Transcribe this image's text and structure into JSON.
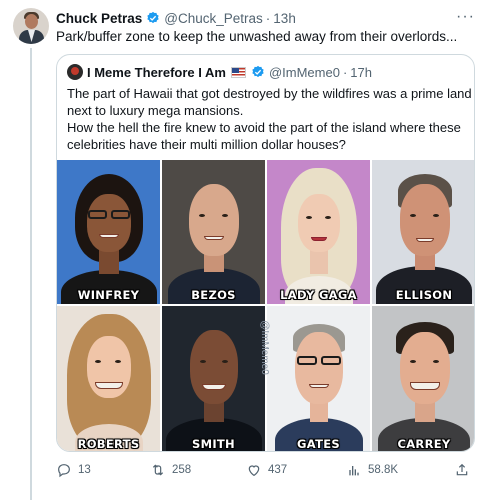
{
  "tweet": {
    "author_name": "Chuck Petras",
    "author_handle": "@Chuck_Petras",
    "separator": "·",
    "time": "13h",
    "more": "···",
    "text": "Park/buffer zone to keep the unwashed away from their overlords..."
  },
  "quote": {
    "author_name": "I Meme Therefore I Am",
    "author_handle": "@ImMeme0",
    "separator": "·",
    "time": "17h",
    "text": "The part of Hawaii that got destroyed by  the wildfires was a prime land next to luxury mega mansions.\nHow the hell the fire knew to avoid the part of the island where these celebrities have their multi million dollar houses?",
    "watermark": "@ImMeme0",
    "grid": [
      {
        "label": "WINFREY"
      },
      {
        "label": "BEZOS"
      },
      {
        "label": "LADY GAGA"
      },
      {
        "label": "ELLISON"
      },
      {
        "label": "ROBERTS"
      },
      {
        "label": "SMITH"
      },
      {
        "label": "GATES"
      },
      {
        "label": "CARREY"
      }
    ]
  },
  "actions": {
    "reply_count": "13",
    "retweet_count": "258",
    "like_count": "437",
    "views_count": "58.8K"
  },
  "colors": {
    "text": "#0f1419",
    "muted": "#536471",
    "verified": "#1d9bf0",
    "border": "#cfd9de"
  },
  "icons": [
    "avatar",
    "verified-badge-icon",
    "more-icon",
    "flag-us-icon",
    "reply-icon",
    "retweet-icon",
    "like-icon",
    "views-icon",
    "share-icon"
  ]
}
